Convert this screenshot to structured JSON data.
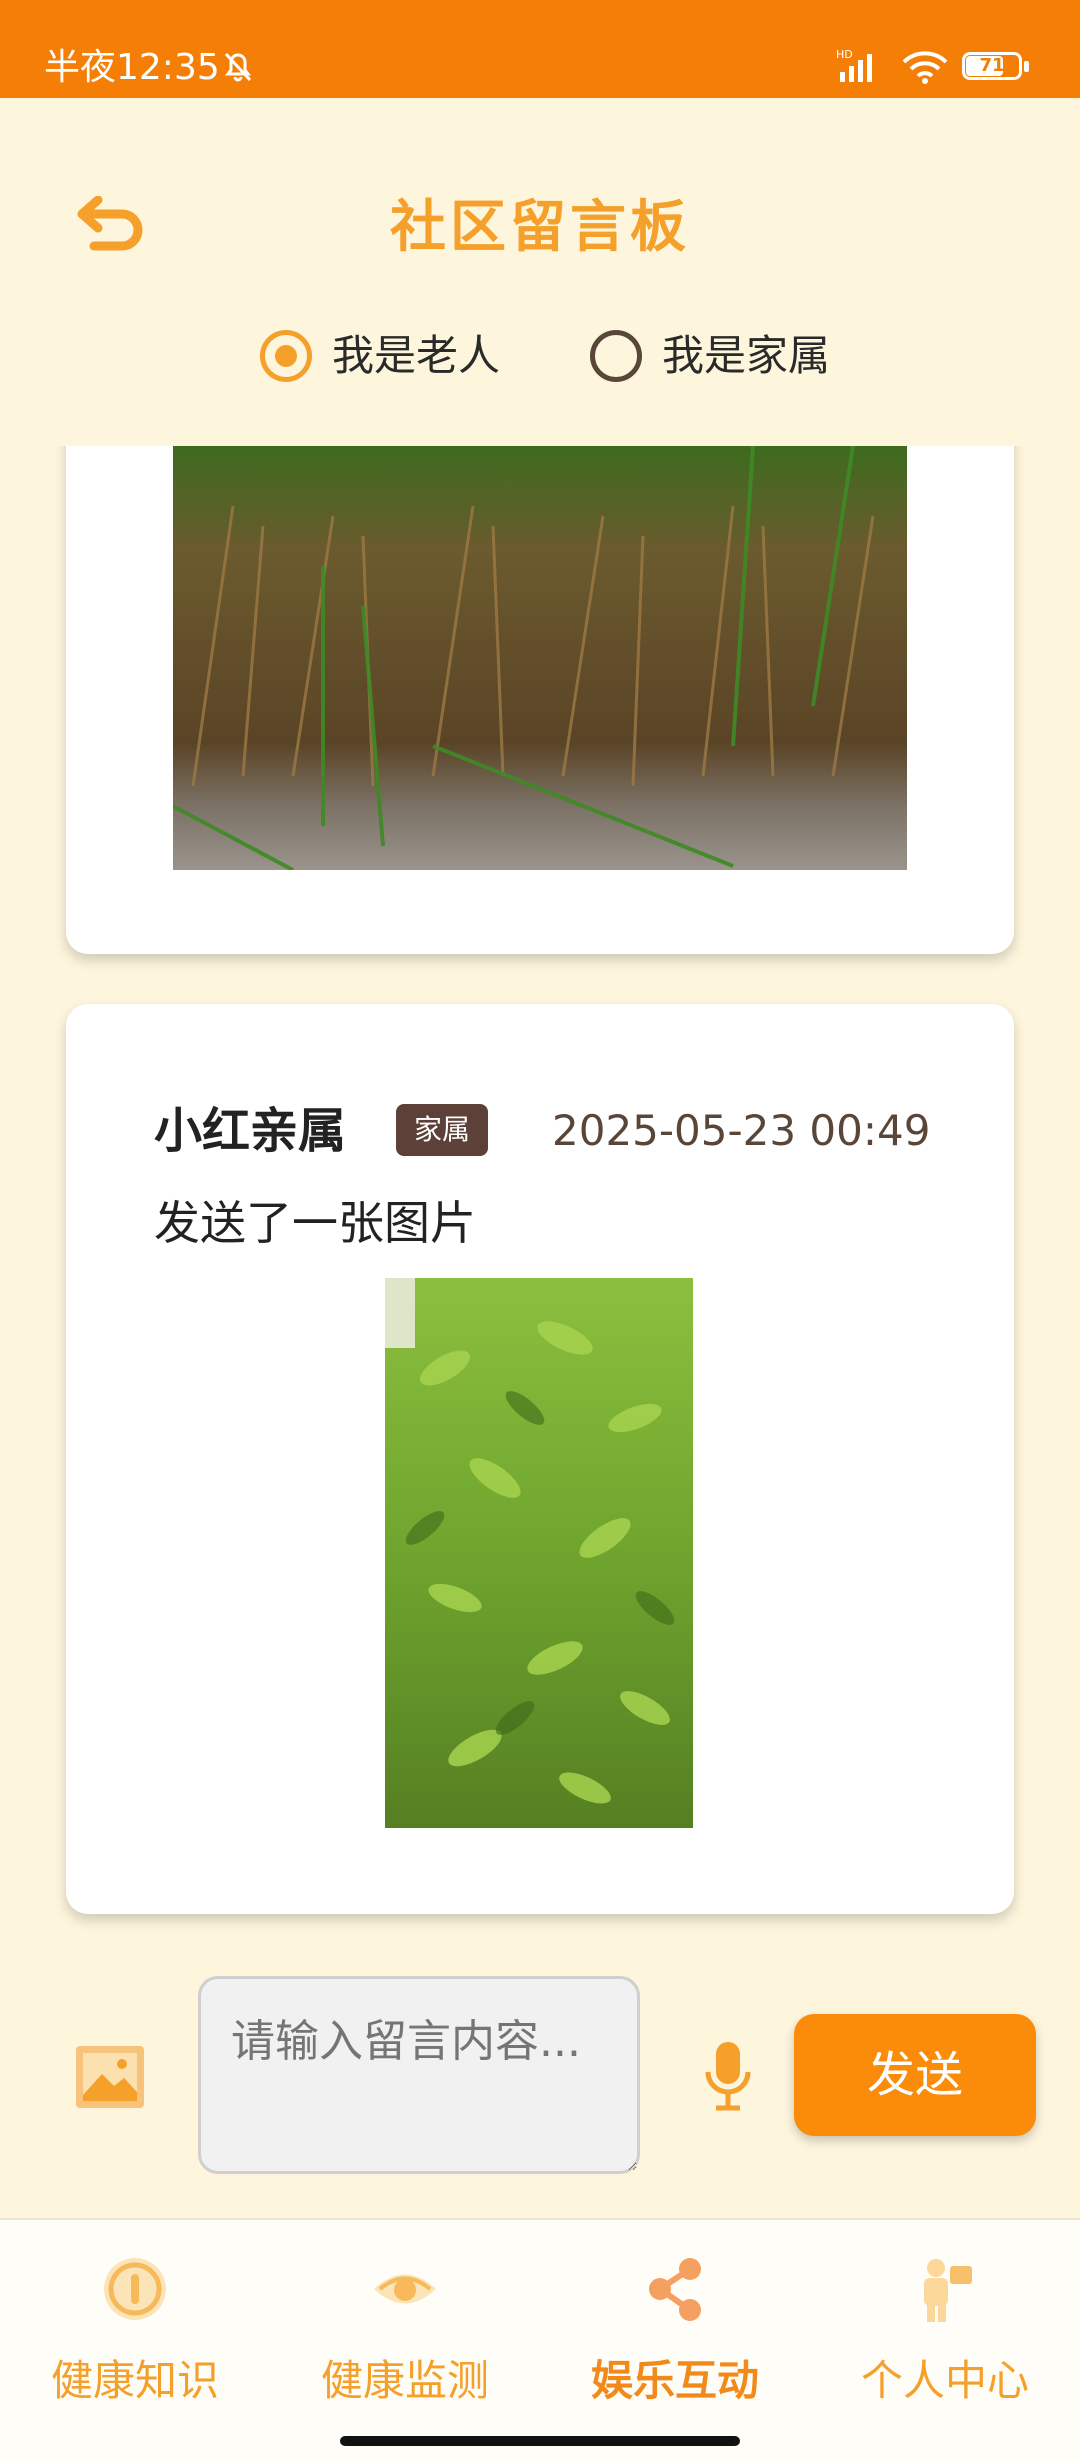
{
  "status_bar": {
    "time": "半夜12:35",
    "battery": "71",
    "battery_level": 0.71
  },
  "header": {
    "title": "社区留言板"
  },
  "roles": [
    {
      "label": "我是老人",
      "selected": true
    },
    {
      "label": "我是家属",
      "selected": false
    }
  ],
  "messages": [
    {
      "image": "grass-photo"
    },
    {
      "author": "小红亲属",
      "badge": "家属",
      "time": "2025-05-23 00:49",
      "text": "发送了一张图片",
      "image": "green-plant-photo"
    }
  ],
  "composer": {
    "placeholder": "请输入留言内容...",
    "send_label": "发送"
  },
  "nav": [
    {
      "label": "健康知识",
      "icon": "info-circle-icon",
      "active": false
    },
    {
      "label": "健康监测",
      "icon": "eye-icon",
      "active": false
    },
    {
      "label": "娱乐互动",
      "icon": "share-icon",
      "active": true
    },
    {
      "label": "个人中心",
      "icon": "person-icon",
      "active": false
    }
  ],
  "colors": {
    "status_bar": "#F57F06",
    "accent": "#F5A02A",
    "send": "#FA8C0A",
    "background": "#FDF5DC",
    "badge": "#5D4037"
  }
}
